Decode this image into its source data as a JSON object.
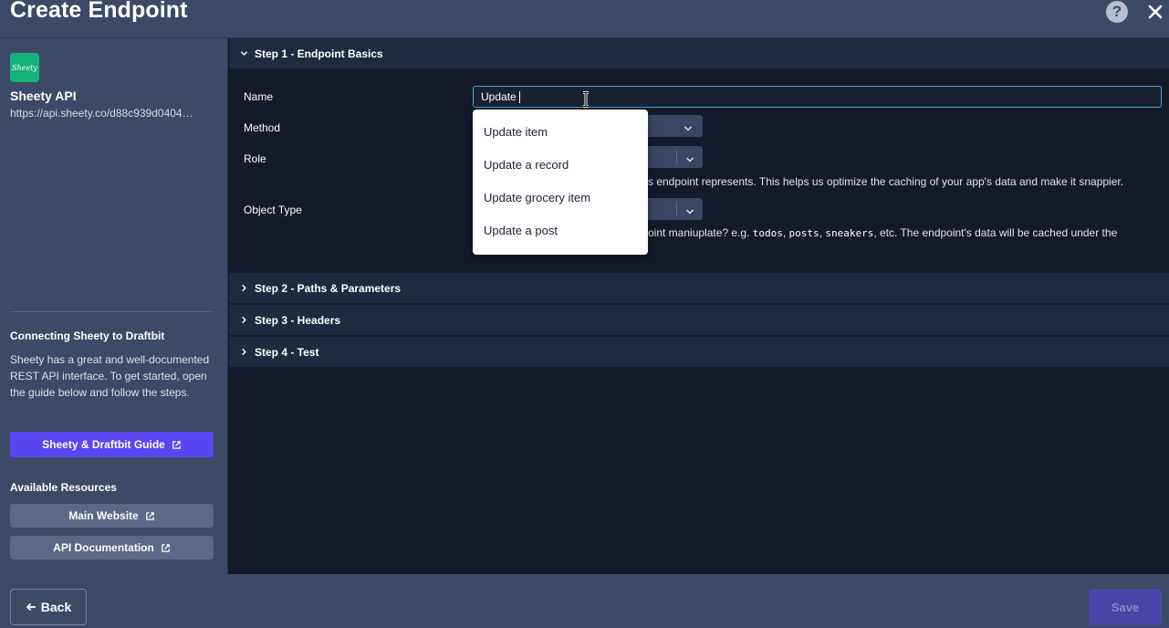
{
  "header": {
    "title": "Create Endpoint",
    "help_label": "?"
  },
  "sidebar": {
    "logo_text": "Sheety",
    "api_name": "Sheety API",
    "api_url": "https://api.sheety.co/d88c939d0404…",
    "connect_title": "Connecting Sheety to Draftbit",
    "connect_desc": "Sheety has a great and well-documented REST API interface. To get started, open the guide below and follow the steps.",
    "guide_button": "Sheety & Draftbit Guide",
    "resources_title": "Available Resources",
    "resources": [
      {
        "label": "Main Website"
      },
      {
        "label": "API Documentation"
      }
    ]
  },
  "steps": [
    {
      "label": "Step 1 - Endpoint Basics",
      "expanded": true
    },
    {
      "label": "Step 2 - Paths & Parameters",
      "expanded": false
    },
    {
      "label": "Step 3 - Headers",
      "expanded": false
    },
    {
      "label": "Step 4 - Test",
      "expanded": false
    }
  ],
  "form": {
    "name_label": "Name",
    "name_value": "Update",
    "method_label": "Method",
    "role_label": "Role",
    "role_help": "s endpoint represents. This helps us optimize the caching of your app's data and make it snappier.",
    "object_type_label": "Object Type",
    "object_help_prefix": "oint maniuplate? e.g. ",
    "object_help_codes": [
      "todos",
      "posts",
      "sneakers"
    ],
    "object_help_suffix": ", etc. The endpoint's data will be cached under the",
    "object_help_sep": ", "
  },
  "dropdown": {
    "items": [
      "Update item",
      "Update a record",
      "Update grocery item",
      "Update a post"
    ]
  },
  "footer": {
    "back_label": "Back",
    "save_label": "Save"
  },
  "colors": {
    "accent": "#5a46f1",
    "panel": "#3c4967",
    "background": "#141a29",
    "logo": "#17b27a",
    "focus": "#3fa8d8"
  },
  "icons": [
    "help-icon",
    "close-icon",
    "external-link-icon",
    "chevron-down-icon",
    "chevron-right-icon",
    "arrow-left-icon",
    "text-cursor-icon"
  ]
}
